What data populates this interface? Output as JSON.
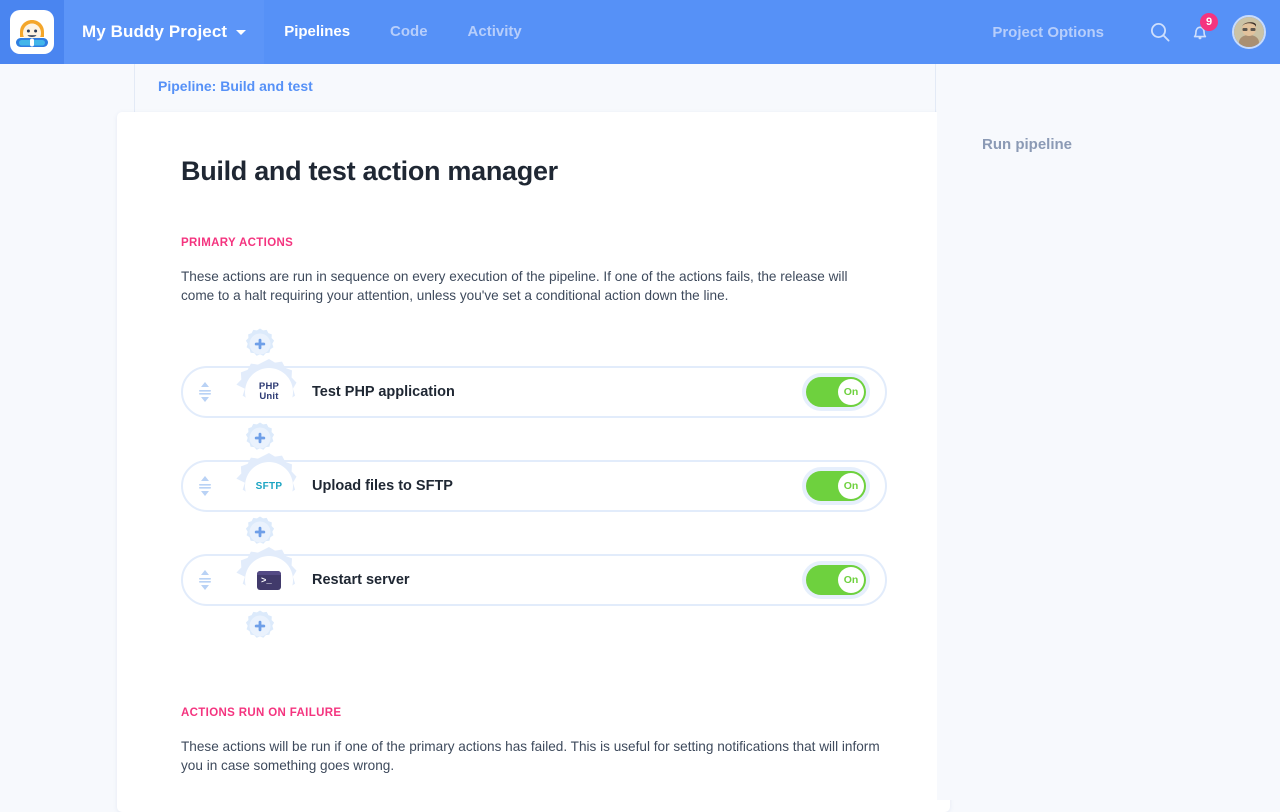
{
  "nav": {
    "logo": "buddy-logo-icon",
    "project_name": "My Buddy Project",
    "links": [
      {
        "label": "Pipelines",
        "active": true
      },
      {
        "label": "Code",
        "active": false
      },
      {
        "label": "Activity",
        "active": false
      }
    ],
    "project_options": "Project Options",
    "search_icon": "search-icon",
    "notifications_icon": "bell-icon",
    "notifications_count": "9",
    "avatar": "user-avatar",
    "brand_color": "#5691f7",
    "badge_color": "#f4347f"
  },
  "breadcrumb": {
    "label": "Pipeline: Build and test"
  },
  "right_panel": {
    "run_pipeline": "Run pipeline"
  },
  "main": {
    "title": "Build and test action manager",
    "primary": {
      "label": "PRIMARY ACTIONS",
      "description": "These actions are run in sequence on every execution of the pipeline. If one of the actions fails, the release will come to a halt requiring your attention, unless you've set a conditional action down the line.",
      "actions": [
        {
          "name": "Test PHP application",
          "icon": "phpunit-icon",
          "icon_text_top": "PHP",
          "icon_text_bottom": "Unit",
          "toggle_label": "On",
          "toggle_state": "on"
        },
        {
          "name": "Upload files to SFTP",
          "icon": "sftp-icon",
          "icon_text": "SFTP",
          "toggle_label": "On",
          "toggle_state": "on"
        },
        {
          "name": "Restart server",
          "icon": "terminal-icon",
          "icon_text": ">_",
          "toggle_label": "On",
          "toggle_state": "on"
        }
      ],
      "add_action_label": "add-action"
    },
    "failure": {
      "label": "ACTIONS RUN ON FAILURE",
      "description": "These actions will be run if one of the primary actions has failed. This is useful for setting notifications that will inform you in case something goes wrong."
    }
  },
  "colors": {
    "accent_pink": "#f4347f",
    "toggle_green": "#6ed13e",
    "link_blue": "#5691f7"
  }
}
